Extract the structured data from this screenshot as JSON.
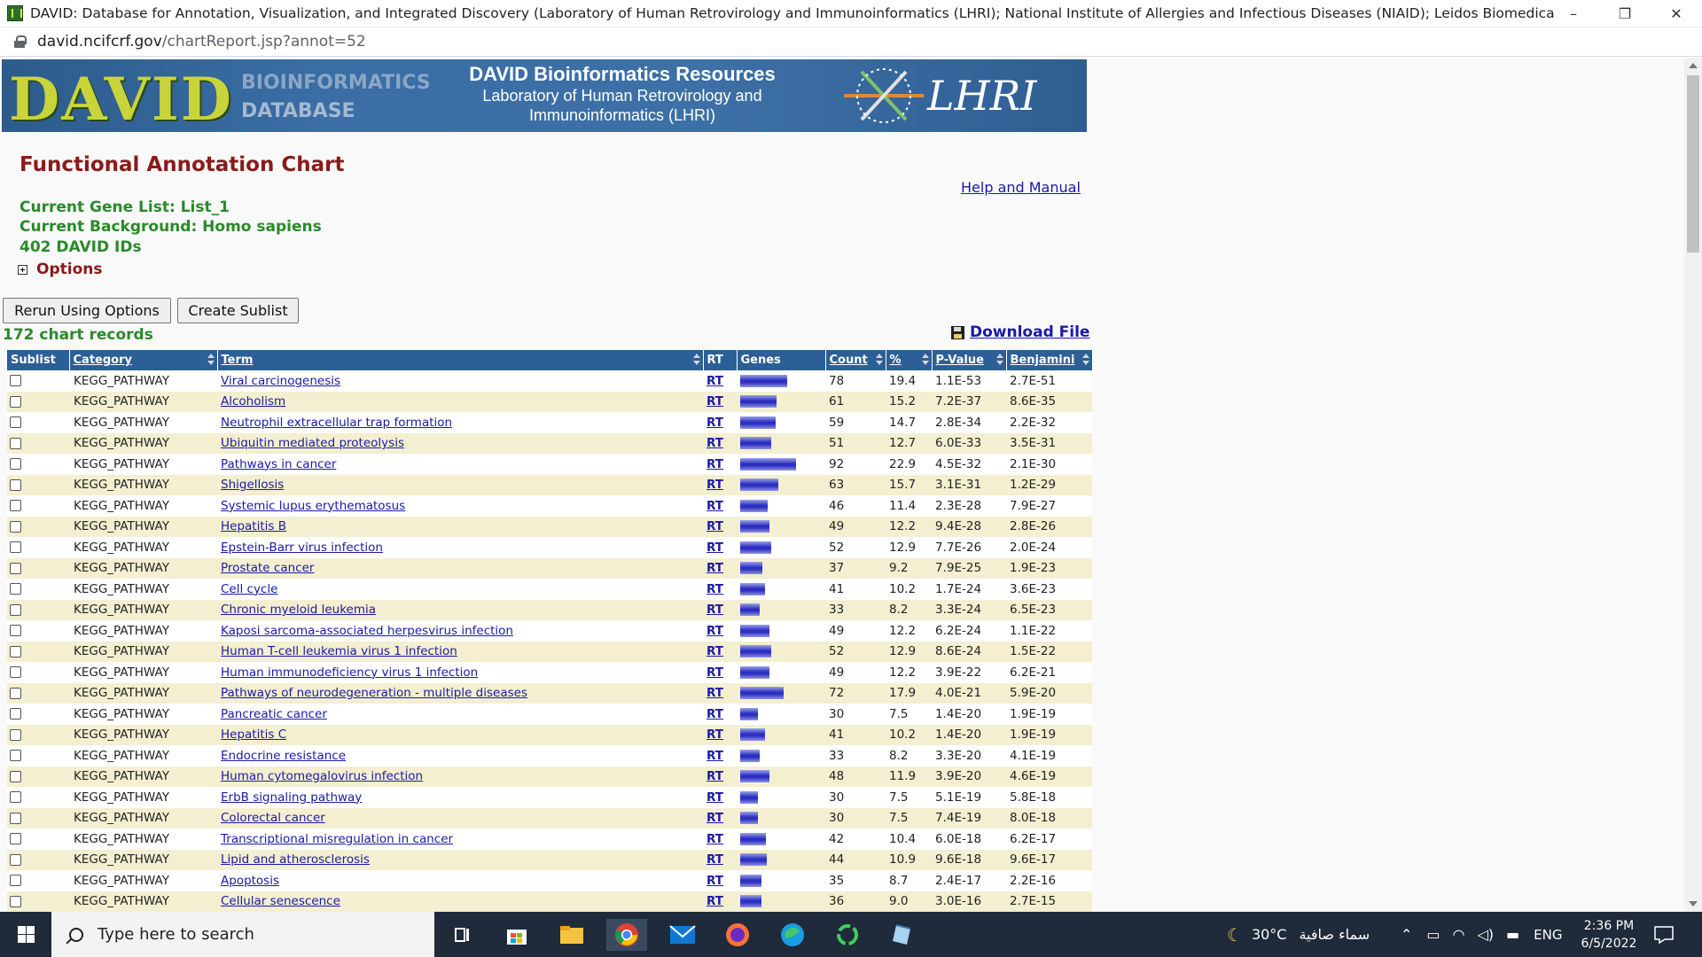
{
  "window": {
    "title": "DAVID: Database for Annotation, Visualization, and Integrated Discovery (Laboratory of Human Retrovirology and Immunoinformatics (LHRI); National Institute of Allergies and Infectious Diseases (NIAID); Leidos Biomedical Research, Inc. (LBR) - Google Chrome",
    "minimize": "–",
    "restore": "❐",
    "close": "✕"
  },
  "address": {
    "host": "david.ncifcrf.gov",
    "path": "/chartReport.jsp?annot=52"
  },
  "banner": {
    "logo_text": "DAVID",
    "logo_sub1": "BIOINFORMATICS",
    "logo_sub2": "DATABASE",
    "heading": "DAVID Bioinformatics Resources",
    "sub1": "Laboratory of Human Retrovirology and",
    "sub2": "Immunoinformatics (LHRI)",
    "lhri": "LHRI"
  },
  "page": {
    "title": "Functional Annotation Chart",
    "help": "Help and Manual",
    "gene_list": "Current Gene List: List_1",
    "background": "Current Background: Homo sapiens",
    "ids": "402 DAVID IDs",
    "options": "Options",
    "rerun": "Rerun Using Options",
    "sublist": "Create Sublist",
    "records": "172 chart records",
    "download": "Download File"
  },
  "table": {
    "headers": {
      "sublist": "Sublist",
      "category": "Category",
      "term": "Term",
      "rt": "RT",
      "genes": "Genes",
      "count": "Count",
      "percent": "%",
      "pvalue": "P-Value",
      "benjamini": "Benjamini"
    },
    "rows": [
      {
        "category": "KEGG_PATHWAY",
        "term": "Viral carcinogenesis",
        "rt": "RT",
        "count": "78",
        "percent": "19.4",
        "pvalue": "1.1E-53",
        "benjamini": "2.7E-51"
      },
      {
        "category": "KEGG_PATHWAY",
        "term": "Alcoholism",
        "rt": "RT",
        "count": "61",
        "percent": "15.2",
        "pvalue": "7.2E-37",
        "benjamini": "8.6E-35"
      },
      {
        "category": "KEGG_PATHWAY",
        "term": "Neutrophil extracellular trap formation",
        "rt": "RT",
        "count": "59",
        "percent": "14.7",
        "pvalue": "2.8E-34",
        "benjamini": "2.2E-32"
      },
      {
        "category": "KEGG_PATHWAY",
        "term": "Ubiquitin mediated proteolysis",
        "rt": "RT",
        "count": "51",
        "percent": "12.7",
        "pvalue": "6.0E-33",
        "benjamini": "3.5E-31"
      },
      {
        "category": "KEGG_PATHWAY",
        "term": "Pathways in cancer",
        "rt": "RT",
        "count": "92",
        "percent": "22.9",
        "pvalue": "4.5E-32",
        "benjamini": "2.1E-30"
      },
      {
        "category": "KEGG_PATHWAY",
        "term": "Shigellosis",
        "rt": "RT",
        "count": "63",
        "percent": "15.7",
        "pvalue": "3.1E-31",
        "benjamini": "1.2E-29"
      },
      {
        "category": "KEGG_PATHWAY",
        "term": "Systemic lupus erythematosus",
        "rt": "RT",
        "count": "46",
        "percent": "11.4",
        "pvalue": "2.3E-28",
        "benjamini": "7.9E-27"
      },
      {
        "category": "KEGG_PATHWAY",
        "term": "Hepatitis B",
        "rt": "RT",
        "count": "49",
        "percent": "12.2",
        "pvalue": "9.4E-28",
        "benjamini": "2.8E-26"
      },
      {
        "category": "KEGG_PATHWAY",
        "term": "Epstein-Barr virus infection",
        "rt": "RT",
        "count": "52",
        "percent": "12.9",
        "pvalue": "7.7E-26",
        "benjamini": "2.0E-24"
      },
      {
        "category": "KEGG_PATHWAY",
        "term": "Prostate cancer",
        "rt": "RT",
        "count": "37",
        "percent": "9.2",
        "pvalue": "7.9E-25",
        "benjamini": "1.9E-23"
      },
      {
        "category": "KEGG_PATHWAY",
        "term": "Cell cycle",
        "rt": "RT",
        "count": "41",
        "percent": "10.2",
        "pvalue": "1.7E-24",
        "benjamini": "3.6E-23"
      },
      {
        "category": "KEGG_PATHWAY",
        "term": "Chronic myeloid leukemia",
        "rt": "RT",
        "count": "33",
        "percent": "8.2",
        "pvalue": "3.3E-24",
        "benjamini": "6.5E-23"
      },
      {
        "category": "KEGG_PATHWAY",
        "term": "Kaposi sarcoma-associated herpesvirus infection",
        "rt": "RT",
        "count": "49",
        "percent": "12.2",
        "pvalue": "6.2E-24",
        "benjamini": "1.1E-22"
      },
      {
        "category": "KEGG_PATHWAY",
        "term": "Human T-cell leukemia virus 1 infection",
        "rt": "RT",
        "count": "52",
        "percent": "12.9",
        "pvalue": "8.6E-24",
        "benjamini": "1.5E-22"
      },
      {
        "category": "KEGG_PATHWAY",
        "term": "Human immunodeficiency virus 1 infection",
        "rt": "RT",
        "count": "49",
        "percent": "12.2",
        "pvalue": "3.9E-22",
        "benjamini": "6.2E-21"
      },
      {
        "category": "KEGG_PATHWAY",
        "term": "Pathways of neurodegeneration - multiple diseases",
        "rt": "RT",
        "count": "72",
        "percent": "17.9",
        "pvalue": "4.0E-21",
        "benjamini": "5.9E-20"
      },
      {
        "category": "KEGG_PATHWAY",
        "term": "Pancreatic cancer",
        "rt": "RT",
        "count": "30",
        "percent": "7.5",
        "pvalue": "1.4E-20",
        "benjamini": "1.9E-19"
      },
      {
        "category": "KEGG_PATHWAY",
        "term": "Hepatitis C",
        "rt": "RT",
        "count": "41",
        "percent": "10.2",
        "pvalue": "1.4E-20",
        "benjamini": "1.9E-19"
      },
      {
        "category": "KEGG_PATHWAY",
        "term": "Endocrine resistance",
        "rt": "RT",
        "count": "33",
        "percent": "8.2",
        "pvalue": "3.3E-20",
        "benjamini": "4.1E-19"
      },
      {
        "category": "KEGG_PATHWAY",
        "term": "Human cytomegalovirus infection",
        "rt": "RT",
        "count": "48",
        "percent": "11.9",
        "pvalue": "3.9E-20",
        "benjamini": "4.6E-19"
      },
      {
        "category": "KEGG_PATHWAY",
        "term": "ErbB signaling pathway",
        "rt": "RT",
        "count": "30",
        "percent": "7.5",
        "pvalue": "5.1E-19",
        "benjamini": "5.8E-18"
      },
      {
        "category": "KEGG_PATHWAY",
        "term": "Colorectal cancer",
        "rt": "RT",
        "count": "30",
        "percent": "7.5",
        "pvalue": "7.4E-19",
        "benjamini": "8.0E-18"
      },
      {
        "category": "KEGG_PATHWAY",
        "term": "Transcriptional misregulation in cancer",
        "rt": "RT",
        "count": "42",
        "percent": "10.4",
        "pvalue": "6.0E-18",
        "benjamini": "6.2E-17"
      },
      {
        "category": "KEGG_PATHWAY",
        "term": "Lipid and atherosclerosis",
        "rt": "RT",
        "count": "44",
        "percent": "10.9",
        "pvalue": "9.6E-18",
        "benjamini": "9.6E-17"
      },
      {
        "category": "KEGG_PATHWAY",
        "term": "Apoptosis",
        "rt": "RT",
        "count": "35",
        "percent": "8.7",
        "pvalue": "2.4E-17",
        "benjamini": "2.2E-16"
      },
      {
        "category": "KEGG_PATHWAY",
        "term": "Cellular senescence",
        "rt": "RT",
        "count": "36",
        "percent": "9.0",
        "pvalue": "3.0E-16",
        "benjamini": "2.7E-15"
      }
    ]
  },
  "taskbar": {
    "search_placeholder": "Type here to search",
    "weather_temp": "30°C",
    "weather_text": "سماء صافية",
    "language": "ENG",
    "time": "2:36 PM",
    "date": "6/5/2022"
  },
  "colors": {
    "header_bg": "#2c5f96",
    "row_alt": "#f3efd0",
    "title_red": "#8b1a1a",
    "info_green": "#2a8a2a",
    "link_blue": "#1a1aa6"
  }
}
